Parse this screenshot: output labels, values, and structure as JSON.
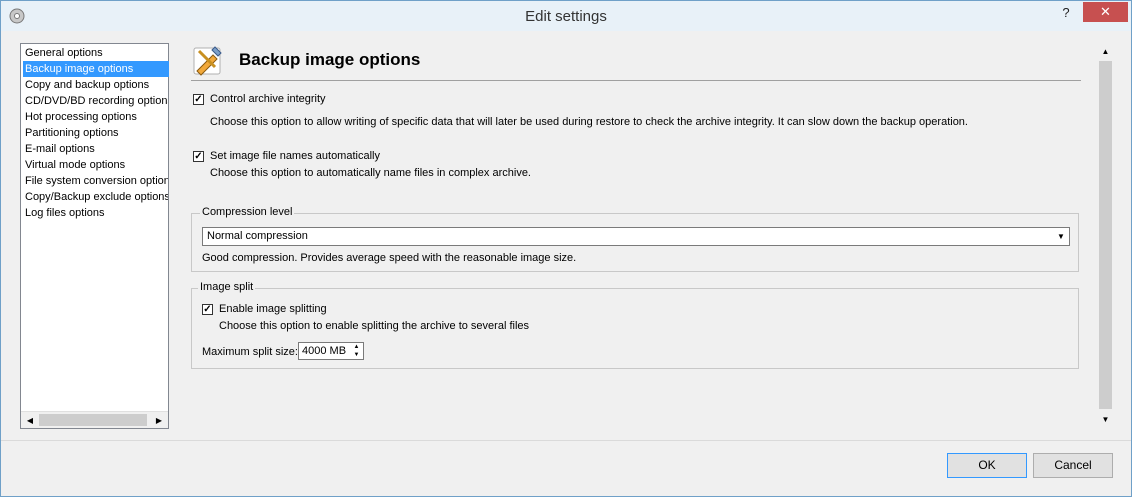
{
  "window": {
    "title": "Edit settings",
    "help_label": "?",
    "close_label": "✕"
  },
  "nav": {
    "items": [
      {
        "label": "General options"
      },
      {
        "label": "Backup image options"
      },
      {
        "label": "Copy and backup options"
      },
      {
        "label": "CD/DVD/BD recording options"
      },
      {
        "label": "Hot processing options"
      },
      {
        "label": "Partitioning options"
      },
      {
        "label": "E-mail options"
      },
      {
        "label": "Virtual mode options"
      },
      {
        "label": "File system conversion options"
      },
      {
        "label": "Copy/Backup exclude options"
      },
      {
        "label": "Log files options"
      }
    ],
    "selected_index": 1
  },
  "panel": {
    "title": "Backup image options",
    "icon": "wrench-pencil-icon",
    "control_integrity": {
      "label": "Control archive integrity",
      "checked": true,
      "description": "Choose this option to allow writing of specific data that will later be used during restore to check the archive integrity. It can slow down the backup operation."
    },
    "auto_names": {
      "label": "Set image file names automatically",
      "checked": true,
      "description": "Choose this option to automatically name files in complex archive."
    },
    "compression": {
      "legend": "Compression level",
      "selected": "Normal compression",
      "description": "Good compression. Provides average speed with the reasonable image size."
    },
    "split": {
      "legend": "Image split",
      "enable_label": "Enable image splitting",
      "checked": true,
      "description": "Choose this option to enable splitting the archive to several files",
      "max_size_label": "Maximum split size:",
      "max_size_value": "4000 MB"
    }
  },
  "buttons": {
    "ok": "OK",
    "cancel": "Cancel"
  },
  "colors": {
    "selection": "#3399ff",
    "close": "#c75050"
  }
}
